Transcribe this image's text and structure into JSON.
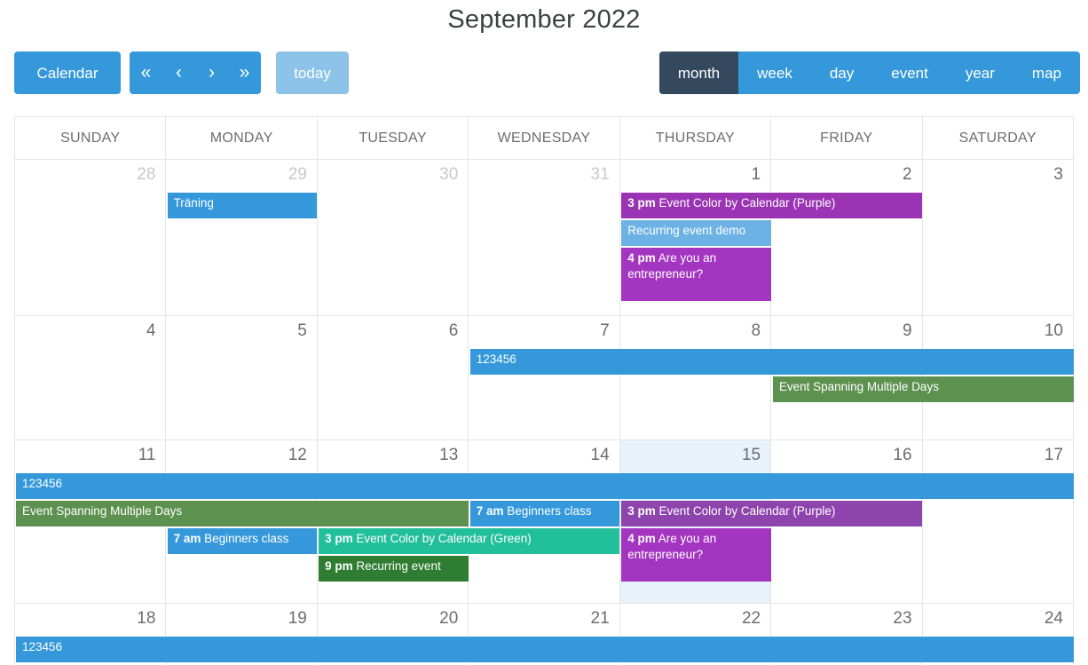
{
  "header": {
    "title": "September 2022"
  },
  "toolbar": {
    "calendar_label": "Calendar",
    "nav": [
      {
        "name": "first",
        "glyph": "«"
      },
      {
        "name": "prev",
        "glyph": "‹"
      },
      {
        "name": "next",
        "glyph": "›"
      },
      {
        "name": "last",
        "glyph": "»"
      }
    ],
    "today_label": "today",
    "views": [
      {
        "label": "month",
        "active": true
      },
      {
        "label": "week",
        "active": false
      },
      {
        "label": "day",
        "active": false
      },
      {
        "label": "event",
        "active": false
      },
      {
        "label": "year",
        "active": false
      },
      {
        "label": "map",
        "active": false
      }
    ]
  },
  "colors": {
    "primary": "#3498db",
    "light_blue": "#6cb2e4",
    "active_view": "#34495e",
    "today_btn": "#8dc3e8",
    "purple": "#9b33b5",
    "purple_dark": "#a435c1",
    "green": "#5d9150",
    "green_dark": "#2e7d32",
    "teal": "#21bf9a",
    "today_cell": "#e8f2fb",
    "grid_line": "#e6e6e6"
  },
  "weekdays": [
    "SUNDAY",
    "MONDAY",
    "TUESDAY",
    "WEDNESDAY",
    "THURSDAY",
    "FRIDAY",
    "SATURDAY"
  ],
  "weeks": [
    {
      "days": [
        {
          "num": "28",
          "other": true,
          "today": false
        },
        {
          "num": "29",
          "other": true,
          "today": false
        },
        {
          "num": "30",
          "other": true,
          "today": false
        },
        {
          "num": "31",
          "other": true,
          "today": false
        },
        {
          "num": "1",
          "other": false,
          "today": false
        },
        {
          "num": "2",
          "other": false,
          "today": false
        },
        {
          "num": "3",
          "other": false,
          "today": false
        }
      ],
      "events": [
        {
          "time": "",
          "title": "Träning",
          "color": "c-blue",
          "start": 1,
          "span": 1,
          "row": 0,
          "lines": 1
        },
        {
          "time": "3 pm",
          "title": "Event Color by Calendar (Purple)",
          "color": "c-purple",
          "start": 4,
          "span": 2,
          "row": 0,
          "lines": 1
        },
        {
          "time": "",
          "title": "Recurring event demo",
          "color": "c-ltblue",
          "start": 4,
          "span": 1,
          "row": 1,
          "lines": 1
        },
        {
          "time": "4 pm",
          "title": "Are you an entrepreneur?",
          "color": "c-purple2",
          "start": 4,
          "span": 1,
          "row": 2,
          "lines": 2
        }
      ]
    },
    {
      "days": [
        {
          "num": "4",
          "other": false,
          "today": false
        },
        {
          "num": "5",
          "other": false,
          "today": false
        },
        {
          "num": "6",
          "other": false,
          "today": false
        },
        {
          "num": "7",
          "other": false,
          "today": false
        },
        {
          "num": "8",
          "other": false,
          "today": false
        },
        {
          "num": "9",
          "other": false,
          "today": false
        },
        {
          "num": "10",
          "other": false,
          "today": false
        }
      ],
      "events": [
        {
          "time": "",
          "title": "123456",
          "color": "c-blue",
          "start": 3,
          "span": 4,
          "row": 0,
          "lines": 1
        },
        {
          "time": "",
          "title": "Event Spanning Multiple Days",
          "color": "c-green",
          "start": 5,
          "span": 2,
          "row": 1,
          "lines": 1
        }
      ]
    },
    {
      "days": [
        {
          "num": "11",
          "other": false,
          "today": false
        },
        {
          "num": "12",
          "other": false,
          "today": false
        },
        {
          "num": "13",
          "other": false,
          "today": false
        },
        {
          "num": "14",
          "other": false,
          "today": false
        },
        {
          "num": "15",
          "other": false,
          "today": true
        },
        {
          "num": "16",
          "other": false,
          "today": false
        },
        {
          "num": "17",
          "other": false,
          "today": false
        }
      ],
      "events": [
        {
          "time": "",
          "title": "123456",
          "color": "c-blue",
          "start": 0,
          "span": 7,
          "row": 0,
          "lines": 1
        },
        {
          "time": "",
          "title": "Event Spanning Multiple Days",
          "color": "c-green",
          "start": 0,
          "span": 3,
          "row": 1,
          "lines": 1
        },
        {
          "time": "7 am",
          "title": "Beginners class",
          "color": "c-blue",
          "start": 3,
          "span": 1,
          "row": 1,
          "lines": 1
        },
        {
          "time": "3 pm",
          "title": "Event Color by Calendar (Purple)",
          "color": "c-plum",
          "start": 4,
          "span": 2,
          "row": 1,
          "lines": 1
        },
        {
          "time": "7 am",
          "title": "Beginners class",
          "color": "c-blue",
          "start": 1,
          "span": 1,
          "row": 2,
          "lines": 1
        },
        {
          "time": "3 pm",
          "title": "Event Color by Calendar (Green)",
          "color": "c-teal",
          "start": 2,
          "span": 2,
          "row": 2,
          "lines": 1
        },
        {
          "time": "4 pm",
          "title": "Are you an entrepreneur?",
          "color": "c-purple2",
          "start": 4,
          "span": 1,
          "row": 2,
          "lines": 2
        },
        {
          "time": "9 pm",
          "title": "Recurring event",
          "color": "c-dgreen",
          "start": 2,
          "span": 1,
          "row": 3,
          "lines": 1
        }
      ]
    },
    {
      "days": [
        {
          "num": "18",
          "other": false,
          "today": false
        },
        {
          "num": "19",
          "other": false,
          "today": false
        },
        {
          "num": "20",
          "other": false,
          "today": false
        },
        {
          "num": "21",
          "other": false,
          "today": false
        },
        {
          "num": "22",
          "other": false,
          "today": false
        },
        {
          "num": "23",
          "other": false,
          "today": false
        },
        {
          "num": "24",
          "other": false,
          "today": false
        }
      ],
      "events": [
        {
          "time": "",
          "title": "123456",
          "color": "c-blue",
          "start": 0,
          "span": 7,
          "row": 0,
          "lines": 1
        }
      ]
    }
  ]
}
